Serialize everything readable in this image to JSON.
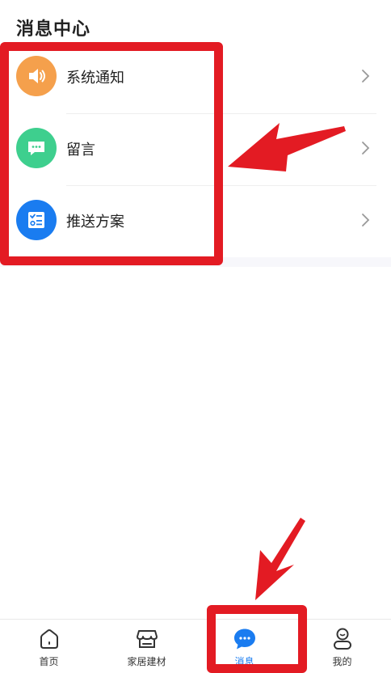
{
  "page": {
    "title": "消息中心"
  },
  "list": {
    "items": [
      {
        "label": "系统通知",
        "icon": "speaker-icon",
        "color": "#f5a04c"
      },
      {
        "label": "留言",
        "icon": "chat-bubble-icon",
        "color": "#3ecf8e"
      },
      {
        "label": "推送方案",
        "icon": "checklist-icon",
        "color": "#1a7cf0"
      }
    ]
  },
  "tabbar": {
    "items": [
      {
        "label": "首页",
        "icon": "home-icon"
      },
      {
        "label": "家居建材",
        "icon": "store-icon"
      },
      {
        "label": "消息",
        "icon": "message-icon",
        "active": true
      },
      {
        "label": "我的",
        "icon": "profile-icon"
      }
    ]
  },
  "colors": {
    "accent": "#1a7cf0",
    "annotation": "#e31b23"
  }
}
